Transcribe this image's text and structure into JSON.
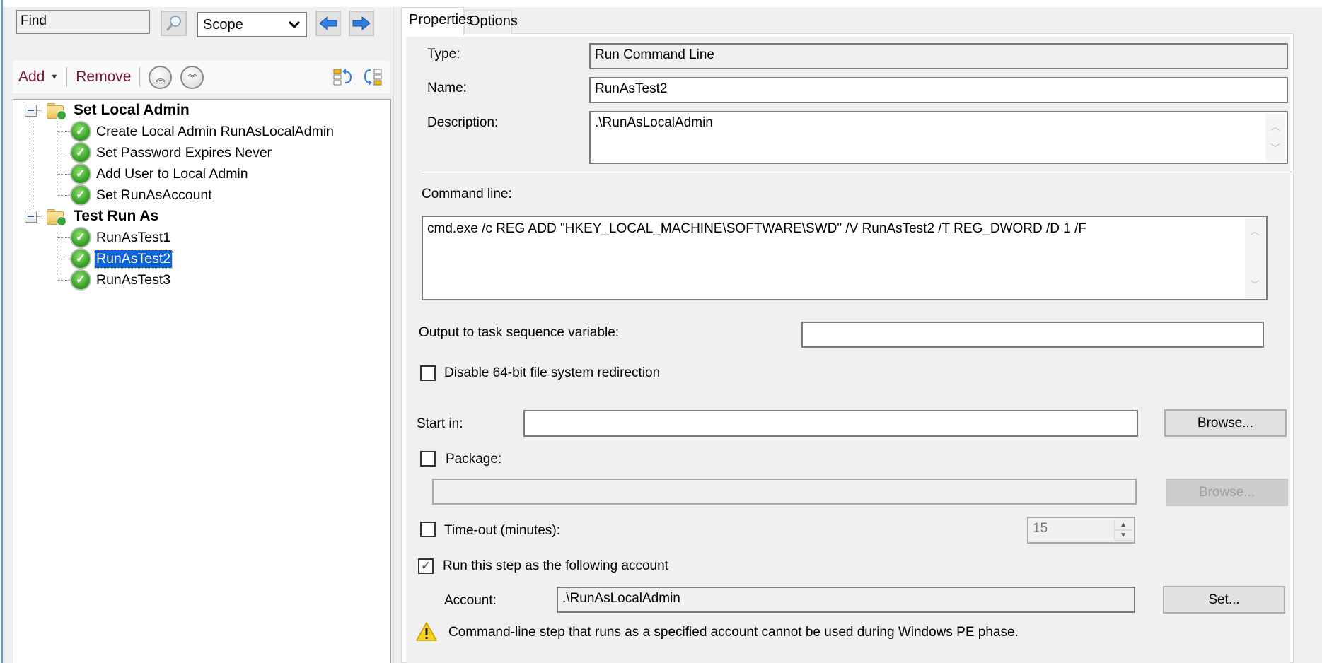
{
  "search": {
    "find_value": "Find",
    "scope_value": "Scope"
  },
  "toolbar": {
    "add_label": "Add",
    "remove_label": "Remove"
  },
  "tree": {
    "groups": [
      {
        "label": "Set Local Admin",
        "expanded": true,
        "items": [
          {
            "label": "Create Local Admin RunAsLocalAdmin",
            "status": "success"
          },
          {
            "label": "Set Password Expires Never",
            "status": "success"
          },
          {
            "label": "Add User to Local Admin",
            "status": "success"
          },
          {
            "label": "Set RunAsAccount",
            "status": "success"
          }
        ]
      },
      {
        "label": "Test Run As",
        "expanded": true,
        "items": [
          {
            "label": "RunAsTest1",
            "status": "success"
          },
          {
            "label": "RunAsTest2",
            "status": "success",
            "selected": true
          },
          {
            "label": "RunAsTest3",
            "status": "success"
          }
        ]
      }
    ]
  },
  "tabs": [
    {
      "label": "Properties",
      "active": true
    },
    {
      "label": "Options",
      "active": false
    }
  ],
  "properties": {
    "type_label": "Type:",
    "type_value": "Run Command Line",
    "name_label": "Name:",
    "name_value": "RunAsTest2",
    "description_label": "Description:",
    "description_value": ".\\RunAsLocalAdmin",
    "command_line_label": "Command line:",
    "command_line_value": "cmd.exe /c REG ADD \"HKEY_LOCAL_MACHINE\\SOFTWARE\\SWD\" /V RunAsTest2 /T REG_DWORD /D 1 /F",
    "output_var_label": "Output to task sequence variable:",
    "output_var_value": "",
    "disable_redirection_label": "Disable 64-bit file system redirection",
    "disable_redirection_checked": false,
    "start_in_label": "Start in:",
    "start_in_value": "",
    "browse_label": "Browse...",
    "package_label": "Package:",
    "package_checked": false,
    "package_value": "",
    "package_browse_label": "Browse...",
    "timeout_label": "Time-out (minutes):",
    "timeout_checked": false,
    "timeout_value": "15",
    "run_as_label": "Run this step as the following account",
    "run_as_checked": true,
    "account_label": "Account:",
    "account_value": ".\\RunAsLocalAdmin",
    "set_label": "Set...",
    "warning_text": "Command-line step that runs as a specified account cannot be used during Windows PE phase."
  },
  "icons": {
    "check": "✓",
    "up": "▲",
    "down": "▼"
  }
}
